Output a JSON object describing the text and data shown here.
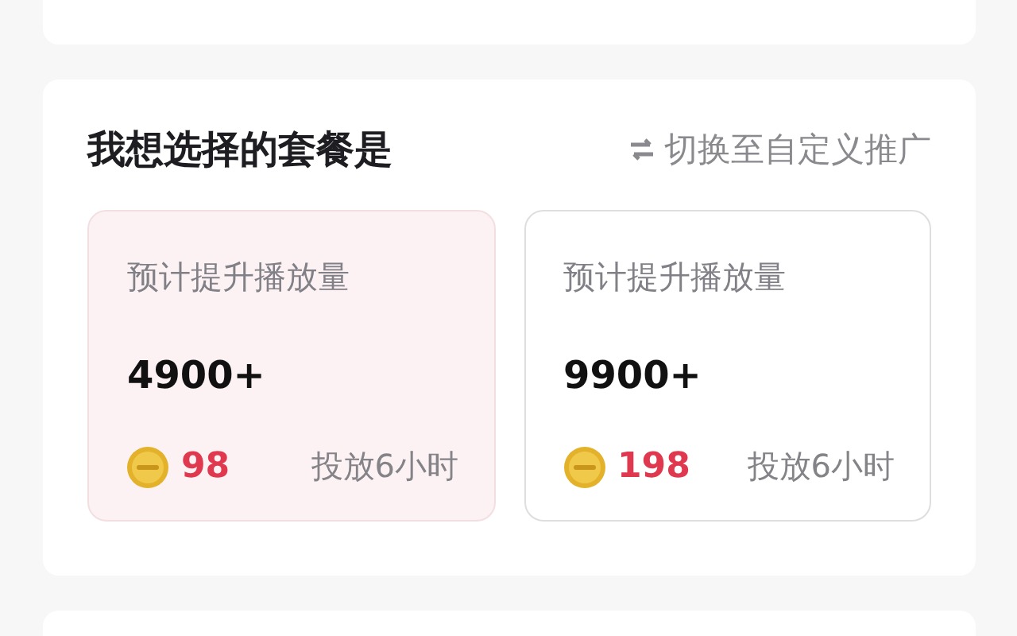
{
  "section": {
    "title": "我想选择的套餐是",
    "switch_link": "切换至自定义推广"
  },
  "packages": [
    {
      "label": "预计提升播放量",
      "value": "4900+",
      "price": "98",
      "duration": "投放6小时",
      "selected": true
    },
    {
      "label": "预计提升播放量",
      "value": "9900+",
      "price": "198",
      "duration": "投放6小时",
      "selected": false
    }
  ]
}
